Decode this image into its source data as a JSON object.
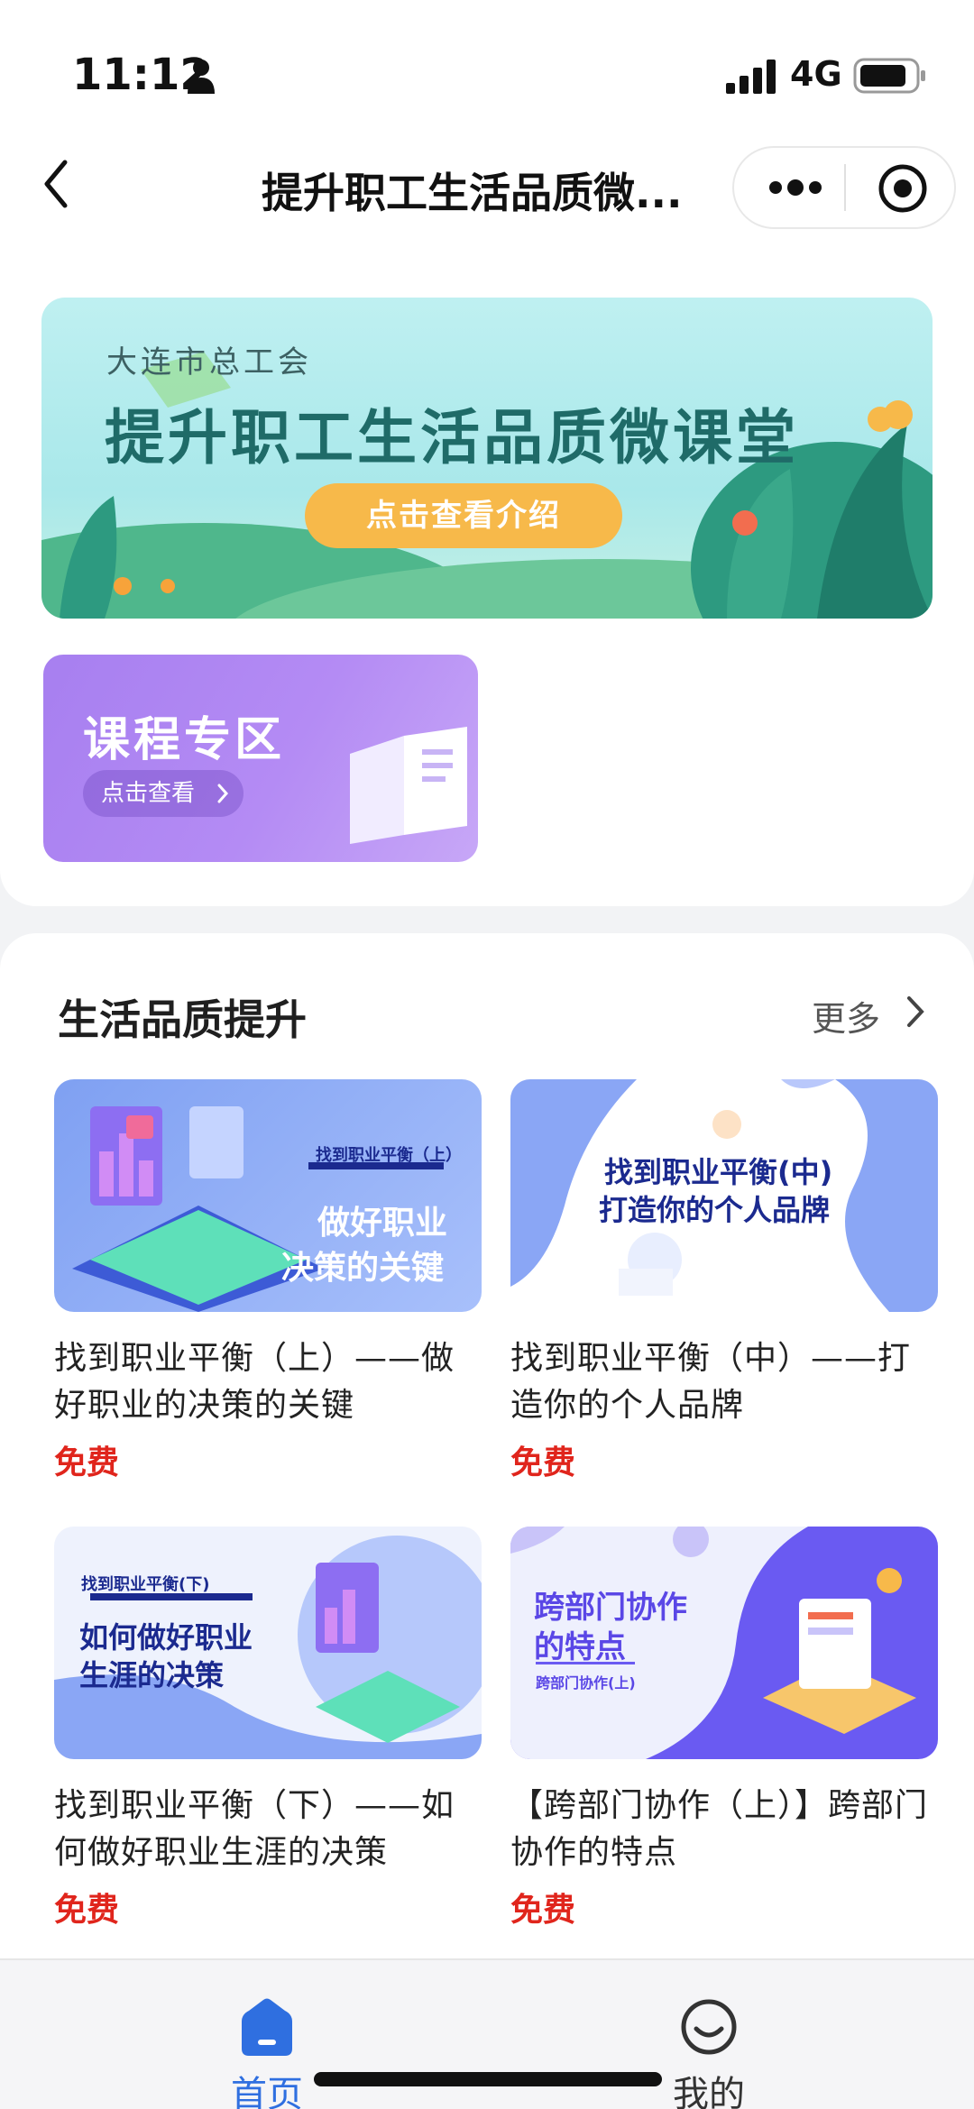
{
  "status_bar": {
    "time": "11:12",
    "network": "4G"
  },
  "nav": {
    "title": "提升职工生活品质微..."
  },
  "banner": {
    "subtitle": "大连市总工会",
    "title": "提升职工生活品质微课堂",
    "button": "点击查看介绍"
  },
  "zone": {
    "title": "课程专区",
    "button": "点击查看"
  },
  "section": {
    "title": "生活品质提升",
    "more": "更多",
    "courses": [
      {
        "title": "找到职业平衡（上）——做好职业的决策的关键",
        "price": "免费",
        "thumb_small": "找到职业平衡（上）",
        "thumb_line1": "做好职业",
        "thumb_line2": "决策的关键"
      },
      {
        "title": "找到职业平衡（中）——打造你的个人品牌",
        "price": "免费",
        "thumb_line1": "找到职业平衡(中)",
        "thumb_line2": "打造你的个人品牌"
      },
      {
        "title": "找到职业平衡（下）——如何做好职业生涯的决策",
        "price": "免费",
        "thumb_small": "找到职业平衡(下)",
        "thumb_line1": "如何做好职业",
        "thumb_line2": "生涯的决策"
      },
      {
        "title": "【跨部门协作（上）】跨部门协作的特点",
        "price": "免费",
        "thumb_line1": "跨部门协作",
        "thumb_line2": "的特点",
        "thumb_small": "跨部门协作(上)"
      }
    ]
  },
  "tabbar": {
    "home": "首页",
    "mine": "我的",
    "active_color": "#2f6fe0",
    "inactive_color": "#333333"
  },
  "colors": {
    "price": "#e0251c",
    "banner_button": "#f7b94a",
    "zone_bg": "#a77ff0"
  }
}
